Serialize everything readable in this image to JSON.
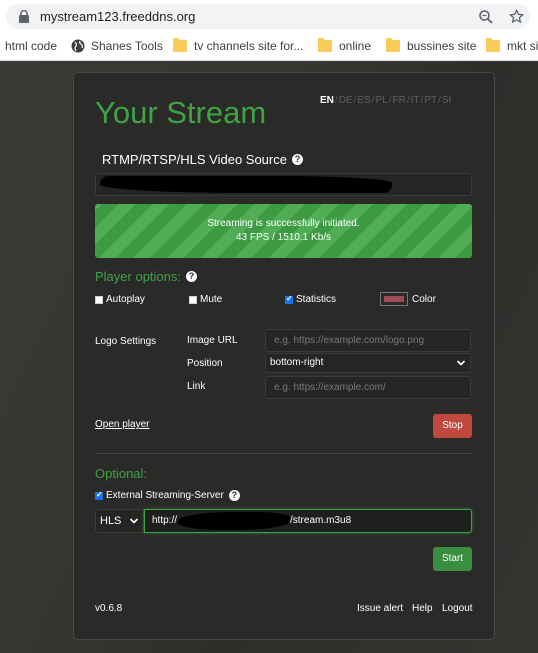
{
  "browser": {
    "url": "mystream123.freeddns.org",
    "bookmarks": [
      {
        "label": "html code",
        "icon": "none"
      },
      {
        "label": "Shanes Tools",
        "icon": "globe-icon"
      },
      {
        "label": "tv channels site for...",
        "icon": "folder-icon"
      },
      {
        "label": "online",
        "icon": "folder-icon"
      },
      {
        "label": "bussines site",
        "icon": "folder-icon"
      },
      {
        "label": "mkt si",
        "icon": "folder-icon"
      }
    ]
  },
  "app": {
    "title": "Your Stream",
    "languages": [
      "EN",
      "DE",
      "ES",
      "PL",
      "FR",
      "IT",
      "PT",
      "SI"
    ],
    "active_language": "EN",
    "source_label": "RTMP/RTSP/HLS Video Source",
    "status_line1": "Streaming is successfully initiated.",
    "status_line2": "43 FPS / 1510.1 Kb/s",
    "player_options_label": "Player options:",
    "options": {
      "autoplay": {
        "label": "Autoplay",
        "checked": false
      },
      "mute": {
        "label": "Mute",
        "checked": false
      },
      "statistics": {
        "label": "Statistics",
        "checked": true
      },
      "color": {
        "label": "Color",
        "value": "#a04a5a"
      }
    },
    "logo": {
      "section_label": "Logo Settings",
      "image_url_label": "Image URL",
      "image_url_placeholder": "e.g. https://example.com/logo.png",
      "position_label": "Position",
      "position_value": "bottom-right",
      "link_label": "Link",
      "link_placeholder": "e.g. https://example.com/"
    },
    "open_player": "Open player",
    "stop": "Stop",
    "optional_label": "Optional:",
    "external_server": {
      "label": "External Streaming-Server",
      "checked": true
    },
    "protocol": "HLS",
    "server_url_prefix": "http://",
    "server_url_suffix": "/stream.m3u8",
    "start": "Start",
    "version": "v0.6.8",
    "footer_links": [
      "Issue alert",
      "Help",
      "Logout"
    ]
  },
  "colors": {
    "accent_green": "#3fa346",
    "stop_red": "#c0483d",
    "start_green": "#3a8f3e"
  }
}
